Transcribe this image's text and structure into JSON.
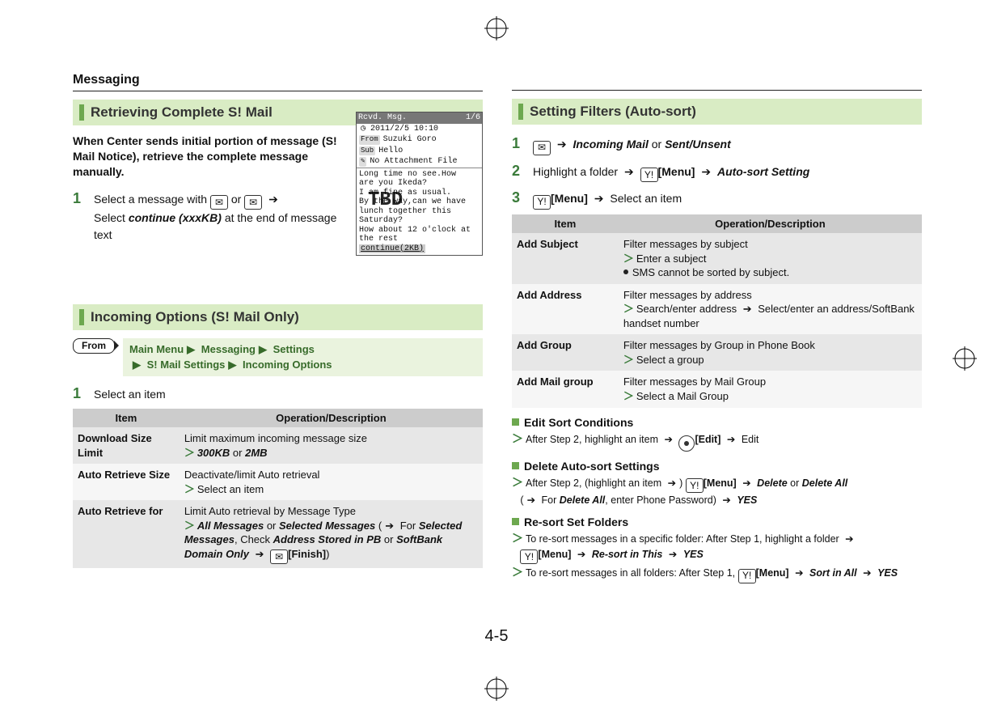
{
  "chapter_label": "Messaging",
  "page_number": "4-5",
  "sections": {
    "retrieve": {
      "title": "Retrieving Complete S! Mail",
      "lead": "When Center sends initial portion of message (S! Mail Notice), retrieve the complete message manually.",
      "step1_a": "Select a message with ",
      "step1_or": " or ",
      "step1_b": "Select ",
      "step1_link": "continue (xxxKB)",
      "step1_c": " at the end of message text"
    },
    "incoming": {
      "title": "Incoming Options (S! Mail Only)",
      "from_label": "From",
      "from_path_parts": [
        "Main Menu",
        "Messaging",
        "Settings",
        "S! Mail Settings",
        "Incoming Options"
      ],
      "step1": "Select an item",
      "thead_item": "Item",
      "thead_desc": "Operation/Description",
      "rows": [
        {
          "item": "Download Size Limit",
          "desc_a": "Limit maximum incoming message size",
          "opt_a": "300KB",
          "or": " or ",
          "opt_b": "2MB"
        },
        {
          "item": "Auto Retrieve Size",
          "desc_a": "Deactivate/limit Auto retrieval",
          "opt_a": "Select an item"
        },
        {
          "item": "Auto Retrieve for",
          "desc_a": "Limit Auto retrieval by Message Type",
          "opt_a": "All Messages",
          "or": " or ",
          "opt_b": "Selected Messages",
          "tail_a": " (",
          "tail_b": " For ",
          "tail_c": "Selected Messages",
          "tail_d": ", Check ",
          "tail_e": "Address Stored in PB",
          "tail_f": " or ",
          "tail_g": "SoftBank Domain Only",
          "tail_h": "[Finish]",
          "tail_i": ")"
        }
      ]
    },
    "phone": {
      "title_left": "Rcvd.  Msg.",
      "title_right": "1/6",
      "date": "2011/2/5 10:10",
      "from_tag": "From",
      "from_val": "Suzuki Goro",
      "sub_tag": "Sub",
      "sub_val": "Hello",
      "att_tag": "✎",
      "att_val": "No Attachment File",
      "body_lines": [
        "Long time no see.How",
        "are you Ikeda?",
        "I am fine as usual.",
        "By the way,can we have",
        "lunch together this",
        "Saturday?",
        "How about 12 o'clock at",
        " the rest"
      ],
      "cont": "continue(2KB)",
      "tbd": "TBD"
    },
    "filters": {
      "title": "Setting Filters (Auto-sort)",
      "step1_a": "Incoming Mail",
      "step1_or": " or ",
      "step1_b": "Sent/Unsent",
      "step2_a": "Highlight a folder ",
      "step2_menu": "[Menu]",
      "step2_b": "Auto-sort Setting",
      "step3_menu": "[Menu]",
      "step3_b": " Select an item",
      "thead_item": "Item",
      "thead_desc": "Operation/Description",
      "rows": [
        {
          "item": "Add Subject",
          "l1": "Filter messages by subject",
          "l2": "Enter a subject",
          "l3": "SMS cannot be sorted by subject."
        },
        {
          "item": "Add Address",
          "l1": "Filter messages by address",
          "l2a": "Search/enter address ",
          "l2b": " Select/enter an address/SoftBank handset number"
        },
        {
          "item": "Add Group",
          "l1": "Filter messages by Group in Phone Book",
          "l2": "Select a group"
        },
        {
          "item": "Add Mail group",
          "l1": "Filter messages by Mail Group",
          "l2": "Select a Mail Group"
        }
      ],
      "edit": {
        "h": "Edit Sort Conditions",
        "line_a": "After Step 2, highlight an item ",
        "edit_lbl": "[Edit]",
        "line_b": " Edit"
      },
      "delete": {
        "h": "Delete Auto-sort Settings",
        "line_a": "After Step 2, (highlight an item ",
        "menu": "[Menu]",
        "del": "Delete",
        "or": " or ",
        "delall": "Delete All",
        "line_b": "(",
        "line_b2": " For ",
        "line_c": ", enter Phone Password) ",
        "yes": "YES"
      },
      "resort": {
        "h": "Re-sort Set Folders",
        "l1a": "To re-sort messages in a specific folder: After Step 1, highlight a folder ",
        "menu": "[Menu]",
        "rs": "Re-sort in This",
        "yes": "YES",
        "l2a": "To re-sort messages in all folders: After Step 1, ",
        "sortall": "Sort in All"
      }
    }
  }
}
